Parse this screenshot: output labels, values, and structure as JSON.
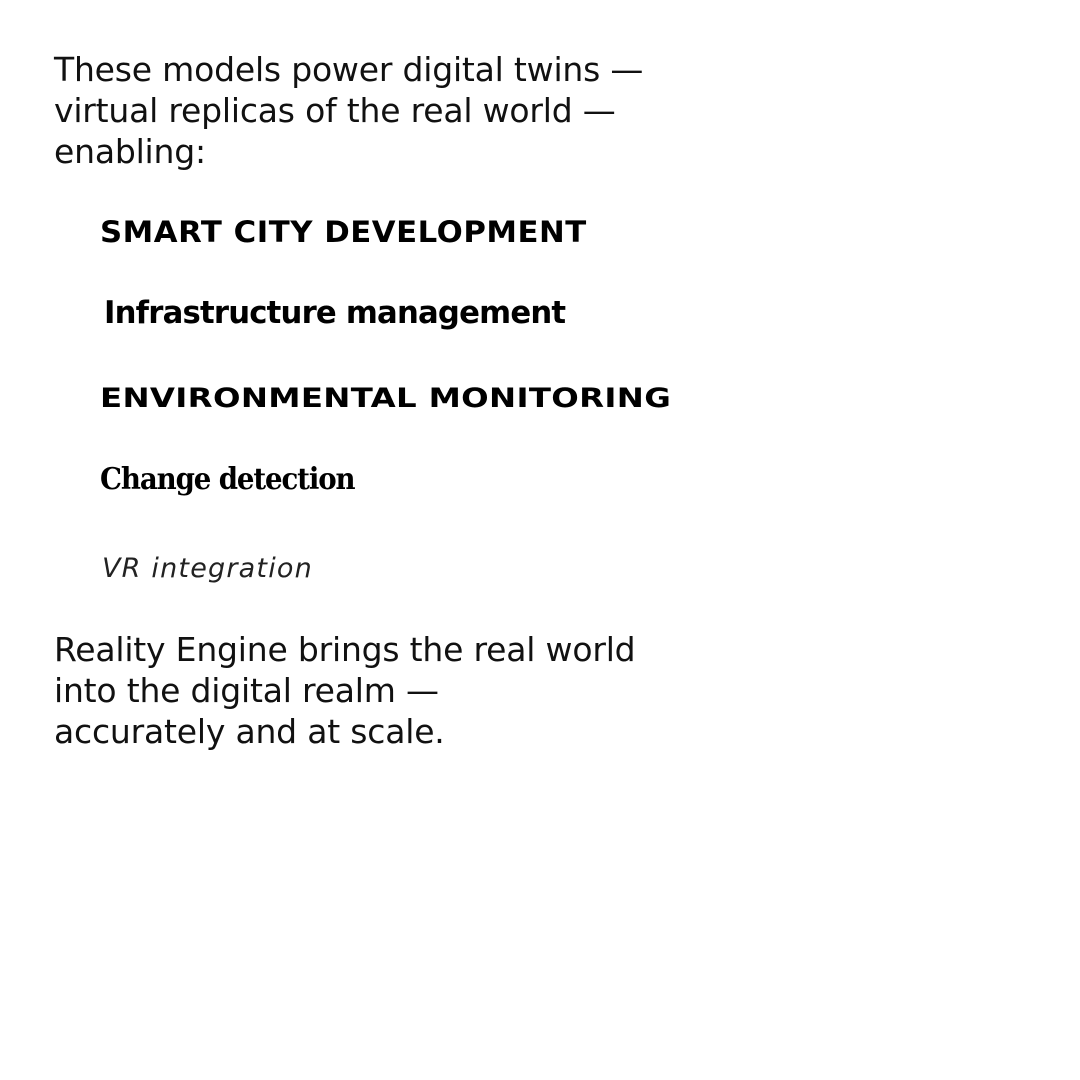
{
  "intro": {
    "lines": [
      "These models power digital twins —",
      "virtual replicas of the real world —",
      "enabling:"
    ]
  },
  "features": [
    "Smart City Development",
    "Infrastructure management",
    "Environmental monitoring",
    "Change detection",
    "VR integration"
  ],
  "outro": {
    "lines": [
      "Reality Engine brings the real world",
      "into the digital realm —",
      "accurately and at scale."
    ]
  },
  "colors": {
    "background": "#ffffff",
    "text": "#111111"
  }
}
